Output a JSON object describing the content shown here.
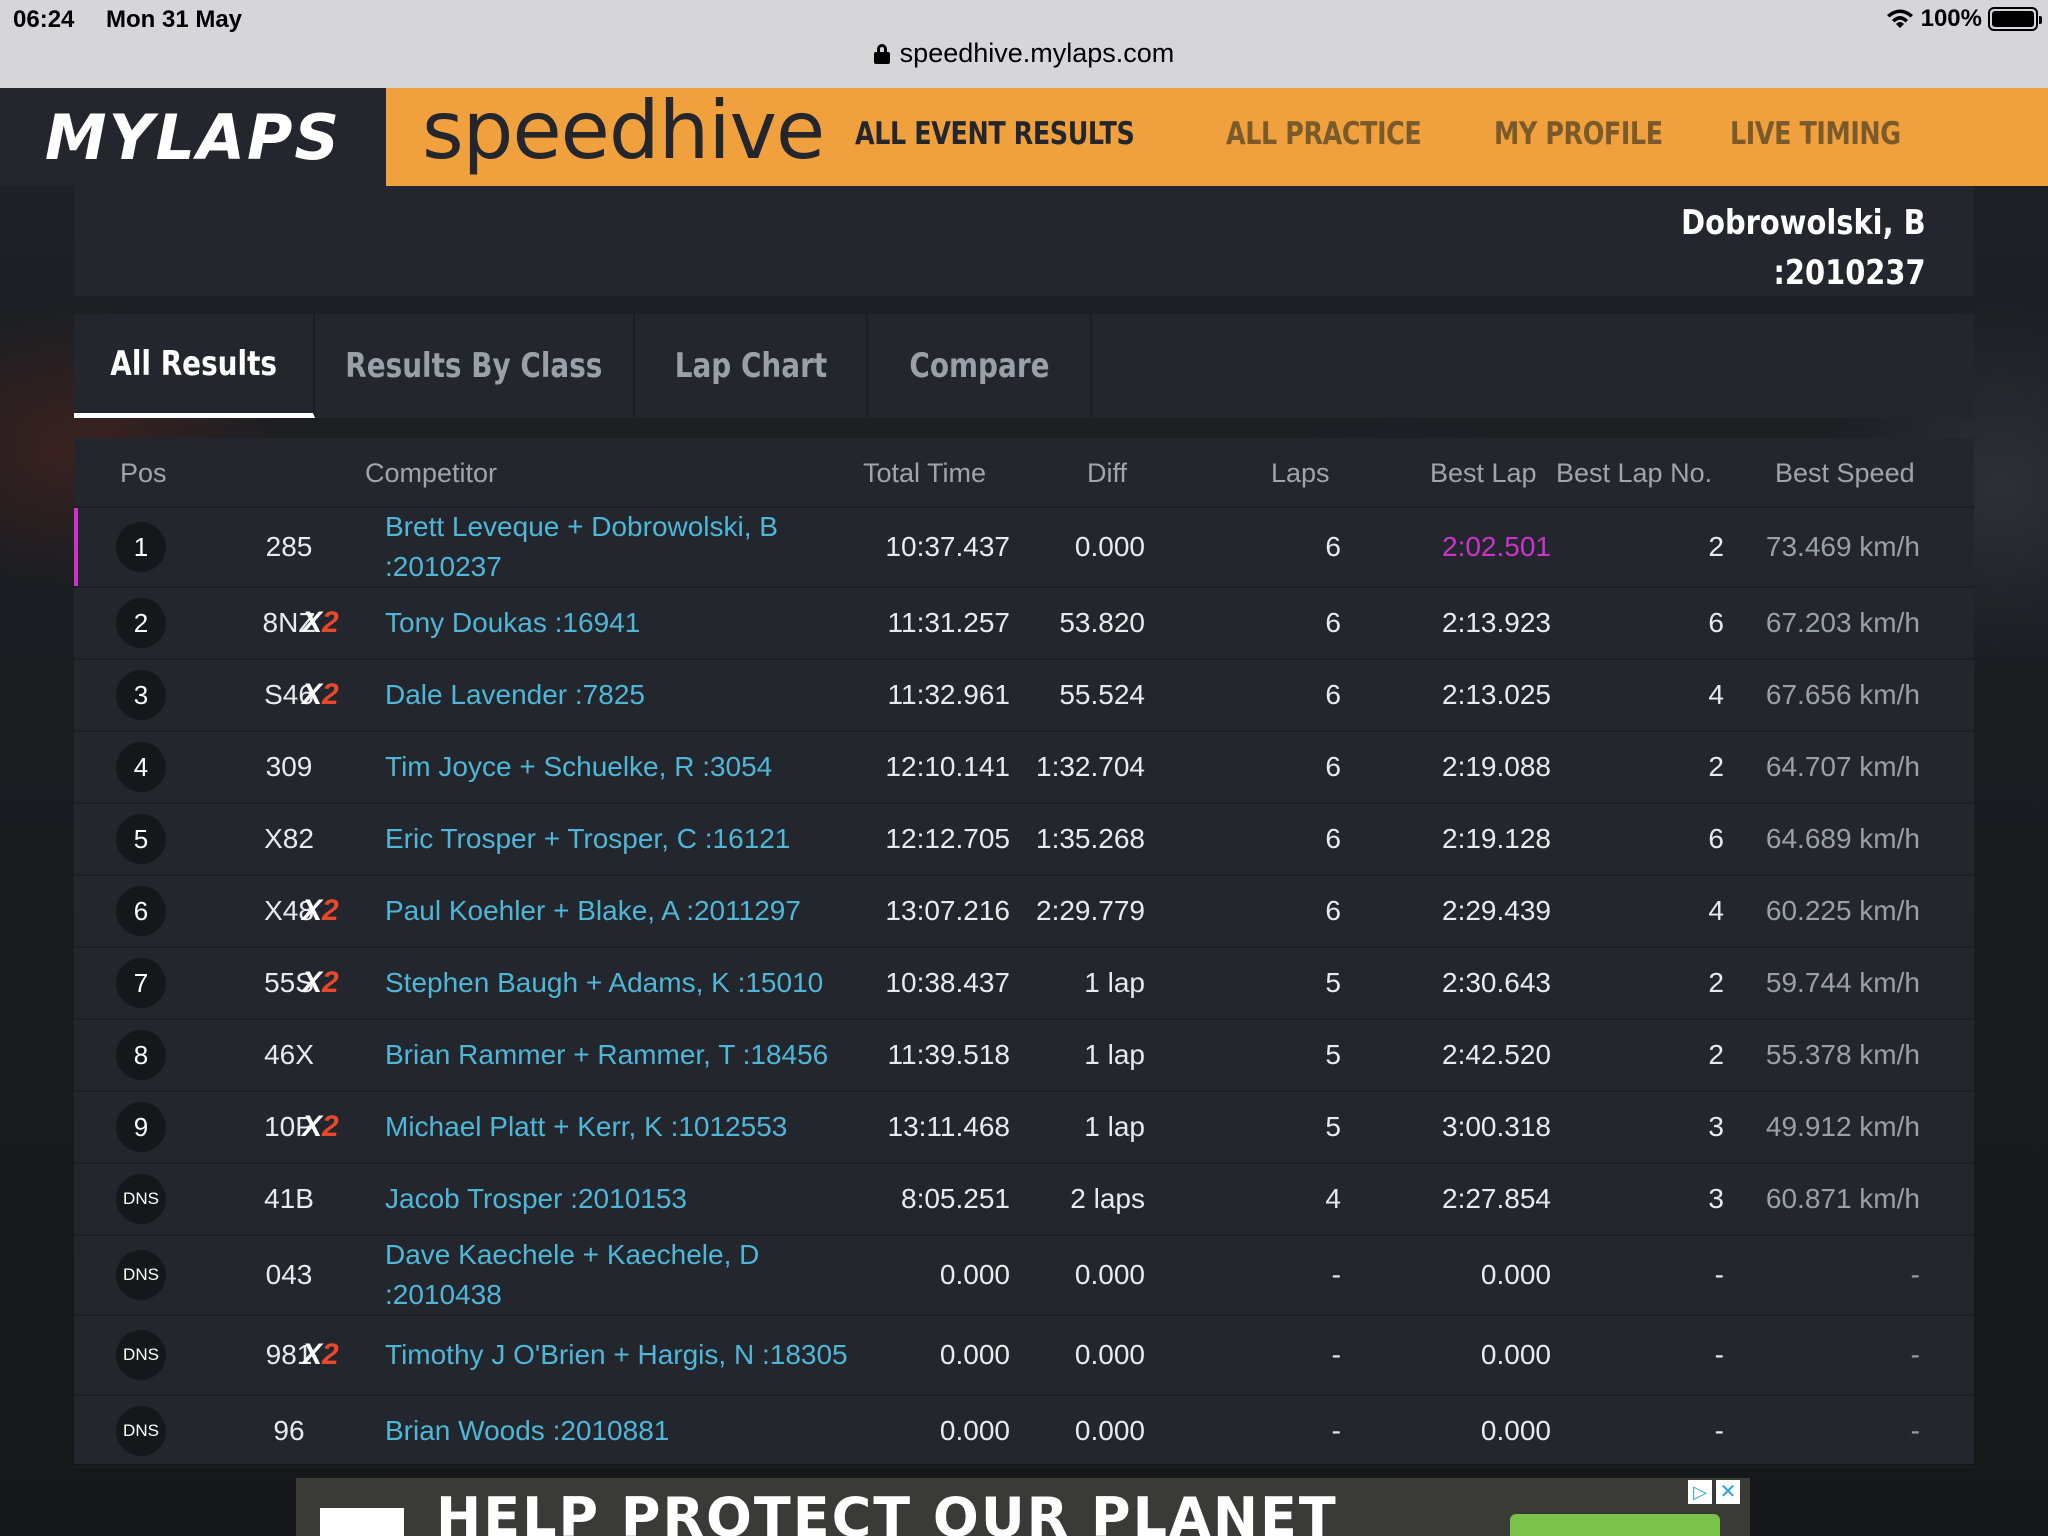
{
  "status_bar": {
    "time": "06:24",
    "date": "Mon 31 May",
    "battery": "100%",
    "url": "speedhive.mylaps.com"
  },
  "header": {
    "logo": "MYLAPS",
    "brand": "speedhive",
    "nav": [
      {
        "label": "ALL EVENT RESULTS",
        "active": true
      },
      {
        "label": "ALL PRACTICE",
        "active": false
      },
      {
        "label": "MY PROFILE",
        "active": false
      },
      {
        "label": "LIVE TIMING",
        "active": false
      }
    ]
  },
  "top_card": {
    "line1": "Dobrowolski, B",
    "line2": ":2010237"
  },
  "tabs": [
    "All Results",
    "Results By Class",
    "Lap Chart",
    "Compare"
  ],
  "table": {
    "headers": {
      "pos": "Pos",
      "competitor": "Competitor",
      "total_time": "Total Time",
      "diff": "Diff",
      "laps": "Laps",
      "best_lap": "Best Lap",
      "best_lap_no": "Best Lap No.",
      "best_speed": "Best Speed"
    },
    "rows": [
      {
        "pos": "1",
        "num": "285",
        "x2": false,
        "competitor": "Brett Leveque + Dobrowolski, B :2010237",
        "total": "10:37.437",
        "diff": "0.000",
        "laps": "6",
        "best": "2:02.501",
        "best_no": "2",
        "speed": "73.469 km/h"
      },
      {
        "pos": "2",
        "num": "8NZ",
        "x2": true,
        "competitor": "Tony Doukas :16941",
        "total": "11:31.257",
        "diff": "53.820",
        "laps": "6",
        "best": "2:13.923",
        "best_no": "6",
        "speed": "67.203 km/h"
      },
      {
        "pos": "3",
        "num": "S46",
        "x2": true,
        "competitor": "Dale Lavender :7825",
        "total": "11:32.961",
        "diff": "55.524",
        "laps": "6",
        "best": "2:13.025",
        "best_no": "4",
        "speed": "67.656 km/h"
      },
      {
        "pos": "4",
        "num": "309",
        "x2": false,
        "competitor": "Tim Joyce + Schuelke, R :3054",
        "total": "12:10.141",
        "diff": "1:32.704",
        "laps": "6",
        "best": "2:19.088",
        "best_no": "2",
        "speed": "64.707 km/h"
      },
      {
        "pos": "5",
        "num": "X82",
        "x2": false,
        "competitor": "Eric Trosper + Trosper, C :16121",
        "total": "12:12.705",
        "diff": "1:35.268",
        "laps": "6",
        "best": "2:19.128",
        "best_no": "6",
        "speed": "64.689 km/h"
      },
      {
        "pos": "6",
        "num": "X48",
        "x2": true,
        "competitor": "Paul Koehler + Blake, A :2011297",
        "total": "13:07.216",
        "diff": "2:29.779",
        "laps": "6",
        "best": "2:29.439",
        "best_no": "4",
        "speed": "60.225 km/h"
      },
      {
        "pos": "7",
        "num": "55S",
        "x2": true,
        "competitor": "Stephen Baugh + Adams, K :15010",
        "total": "10:38.437",
        "diff": "1 lap",
        "laps": "5",
        "best": "2:30.643",
        "best_no": "2",
        "speed": "59.744 km/h"
      },
      {
        "pos": "8",
        "num": "46X",
        "x2": false,
        "competitor": "Brian Rammer + Rammer, T :18456",
        "total": "11:39.518",
        "diff": "1 lap",
        "laps": "5",
        "best": "2:42.520",
        "best_no": "2",
        "speed": "55.378 km/h"
      },
      {
        "pos": "9",
        "num": "10P",
        "x2": true,
        "competitor": "Michael Platt + Kerr, K :1012553",
        "total": "13:11.468",
        "diff": "1 lap",
        "laps": "5",
        "best": "3:00.318",
        "best_no": "3",
        "speed": "49.912 km/h"
      },
      {
        "pos": "DNS",
        "num": "41B",
        "x2": false,
        "competitor": "Jacob Trosper :2010153",
        "total": "8:05.251",
        "diff": "2 laps",
        "laps": "4",
        "best": "2:27.854",
        "best_no": "3",
        "speed": "60.871 km/h"
      },
      {
        "pos": "DNS",
        "num": "043",
        "x2": false,
        "competitor": "Dave Kaechele + Kaechele, D :2010438",
        "total": "0.000",
        "diff": "0.000",
        "laps": "-",
        "best": "0.000",
        "best_no": "-",
        "speed": "-"
      },
      {
        "pos": "DNS",
        "num": "981",
        "x2": true,
        "competitor": "Timothy J O'Brien + Hargis, N :18305",
        "total": "0.000",
        "diff": "0.000",
        "laps": "-",
        "best": "0.000",
        "best_no": "-",
        "speed": "-"
      },
      {
        "pos": "DNS",
        "num": "96",
        "x2": false,
        "competitor": "Brian Woods :2010881",
        "total": "0.000",
        "diff": "0.000",
        "laps": "-",
        "best": "0.000",
        "best_no": "-",
        "speed": "-"
      }
    ],
    "x2_label": {
      "x": "X",
      "two": "2"
    }
  },
  "ad": {
    "text": "HELP PROTECT OUR PLANET"
  },
  "colors": {
    "brand_orange": "#f0a03c",
    "link_blue": "#4fb6d8",
    "best_lap_purple": "#cc33cc",
    "x2_red": "#e8482c"
  }
}
